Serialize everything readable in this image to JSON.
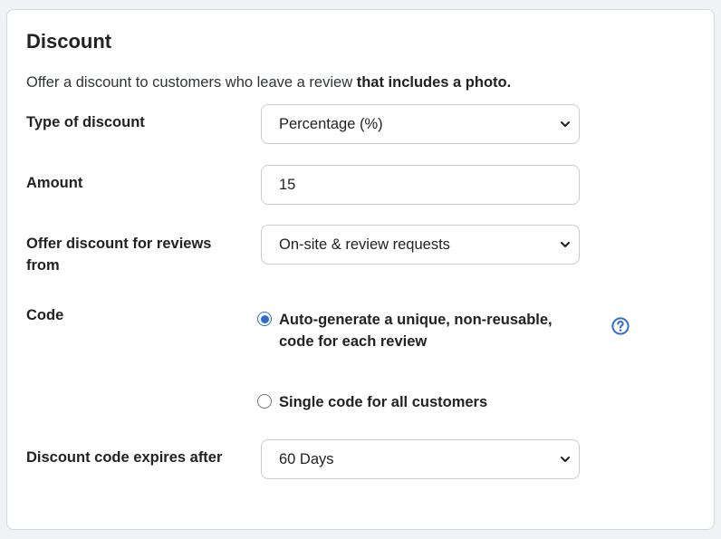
{
  "card": {
    "title": "Discount",
    "intro_text": "Offer a discount to customers who leave a review ",
    "intro_bold": "that includes a photo."
  },
  "type_of_discount": {
    "label": "Type of discount",
    "value": "Percentage (%)"
  },
  "amount": {
    "label": "Amount",
    "value": "15"
  },
  "offer_for": {
    "label": "Offer discount for reviews from",
    "value": "On-site & review requests"
  },
  "code": {
    "label": "Code",
    "options": [
      {
        "label": "Auto-generate a unique, non-reusable, code for each review",
        "checked": true
      },
      {
        "label": "Single code for all customers",
        "checked": false
      }
    ],
    "help_icon": "question-circle-icon"
  },
  "expires": {
    "label": "Discount code expires after",
    "value": "60 Days"
  },
  "colors": {
    "accent": "#2c6ecb",
    "border": "#c9cccf",
    "text": "#202223"
  }
}
